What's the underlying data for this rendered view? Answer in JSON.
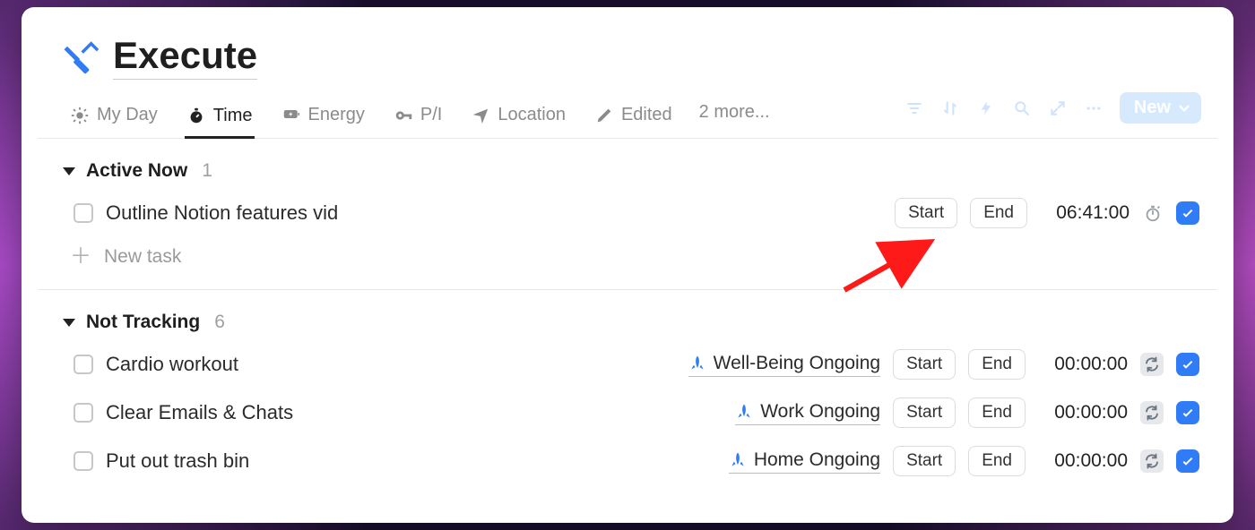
{
  "page": {
    "title": "Execute"
  },
  "tabs": {
    "items": [
      {
        "label": "My Day"
      },
      {
        "label": "Time"
      },
      {
        "label": "Energy"
      },
      {
        "label": "P/I"
      },
      {
        "label": "Location"
      },
      {
        "label": "Edited"
      }
    ],
    "more_label": "2 more...",
    "active_index": 1
  },
  "toolbar": {
    "new_label": "New"
  },
  "groups": {
    "active": {
      "title": "Active Now",
      "count": "1",
      "tasks": [
        {
          "title": "Outline Notion features vid",
          "project": "",
          "start": "Start",
          "end": "End",
          "time": "06:41:00",
          "trailing": "stopwatch"
        }
      ],
      "new_task_label": "New task"
    },
    "not_tracking": {
      "title": "Not Tracking",
      "count": "6",
      "tasks": [
        {
          "title": "Cardio workout",
          "project": "Well-Being Ongoing",
          "start": "Start",
          "end": "End",
          "time": "00:00:00",
          "trailing": "repeat"
        },
        {
          "title": "Clear Emails & Chats",
          "project": "Work Ongoing",
          "start": "Start",
          "end": "End",
          "time": "00:00:00",
          "trailing": "repeat"
        },
        {
          "title": "Put out trash bin",
          "project": "Home Ongoing",
          "start": "Start",
          "end": "End",
          "time": "00:00:00",
          "trailing": "repeat"
        }
      ]
    }
  }
}
